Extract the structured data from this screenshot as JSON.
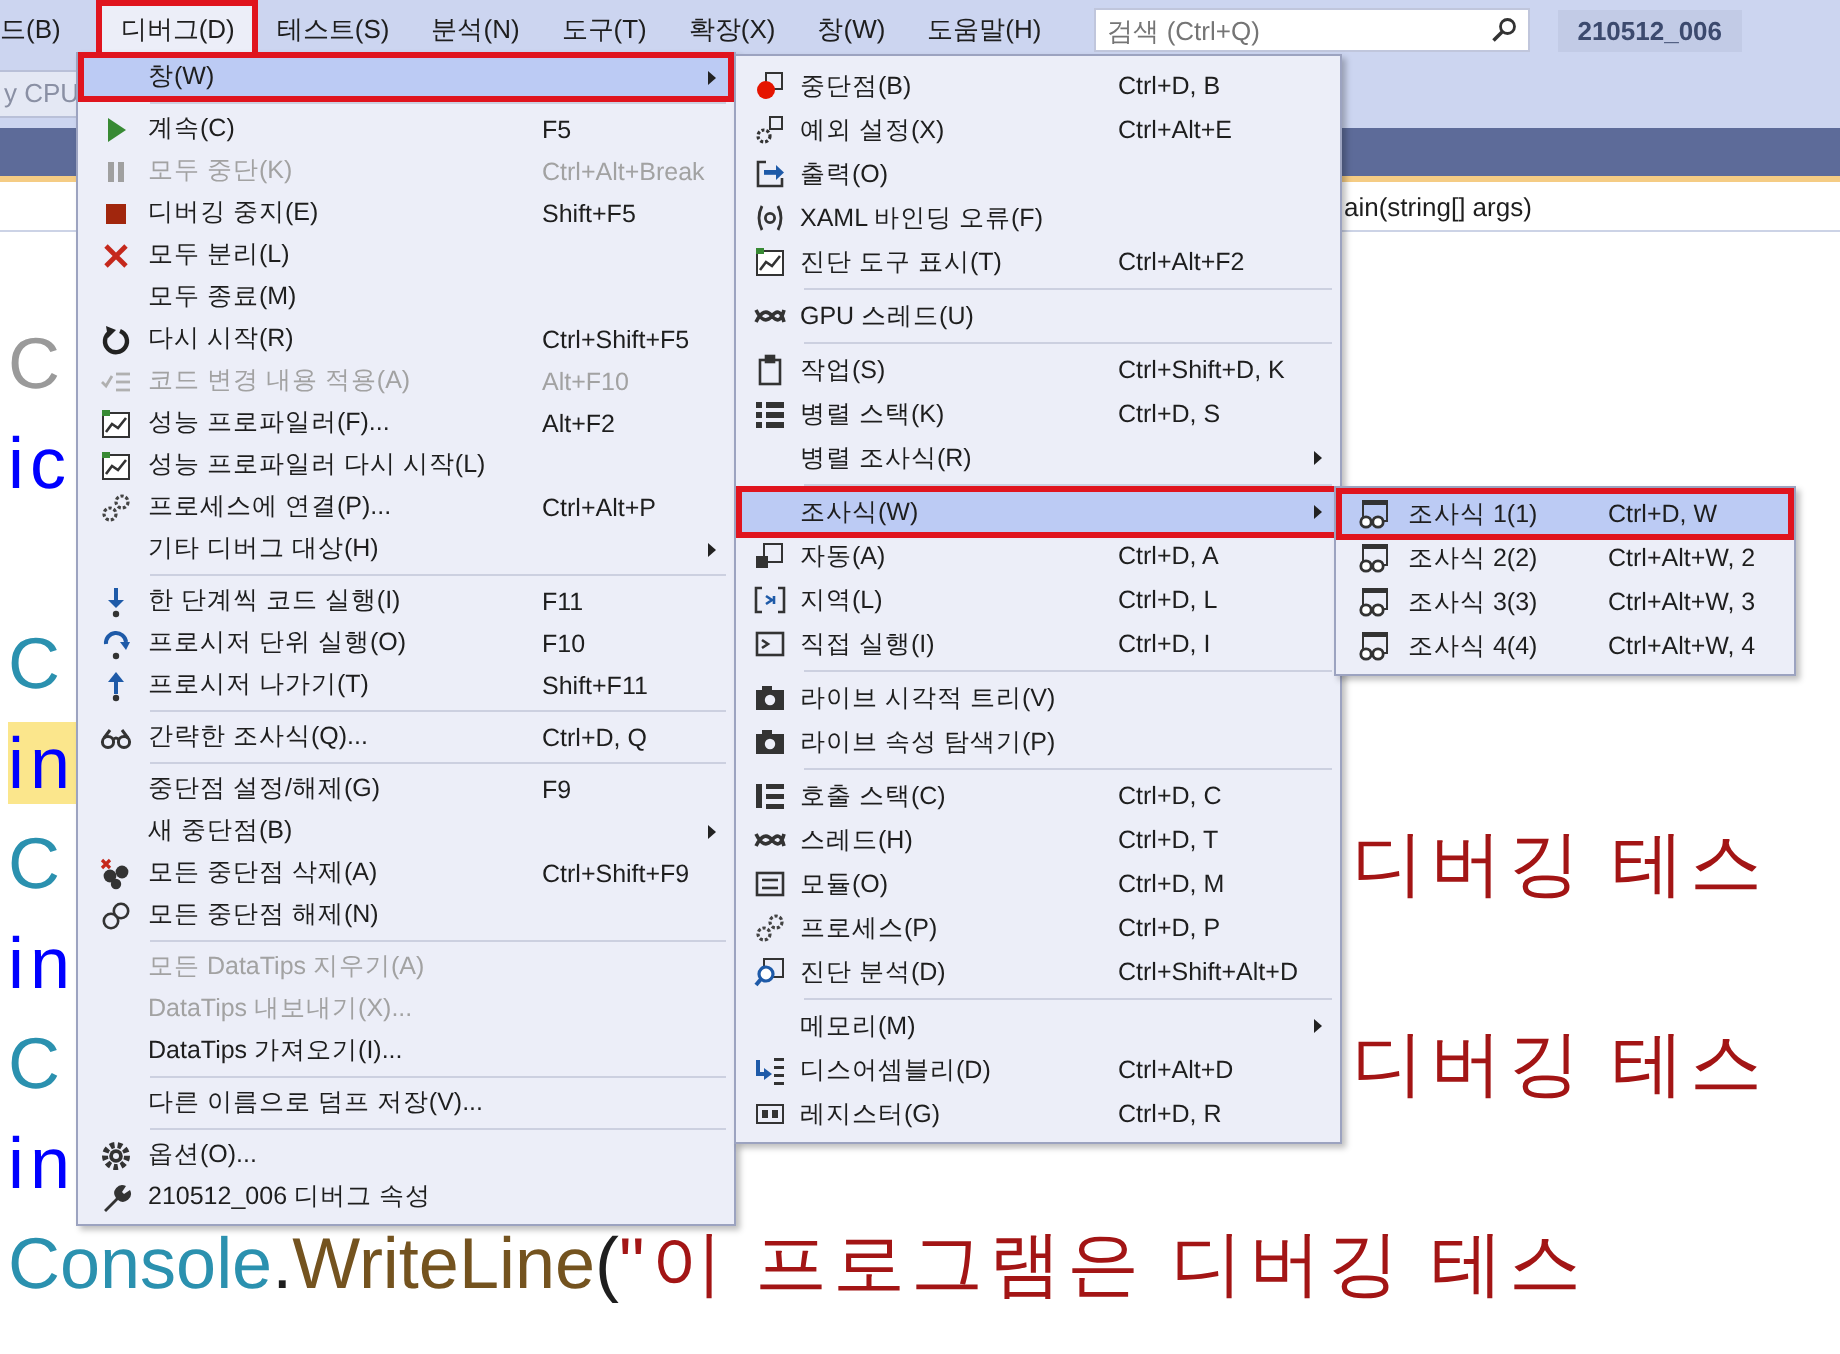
{
  "menubar": [
    {
      "label": "드(B)",
      "selected": false,
      "highlighted": false
    },
    {
      "label": "디버그(D)",
      "selected": true,
      "highlighted": true
    },
    {
      "label": "테스트(S)",
      "selected": false,
      "highlighted": false
    },
    {
      "label": "분석(N)",
      "selected": false,
      "highlighted": false
    },
    {
      "label": "도구(T)",
      "selected": false,
      "highlighted": false
    },
    {
      "label": "확장(X)",
      "selected": false,
      "highlighted": false
    },
    {
      "label": "창(W)",
      "selected": false,
      "highlighted": false
    },
    {
      "label": "도움말(H)",
      "selected": false,
      "highlighted": false
    }
  ],
  "search": {
    "placeholder": "검색 (Ctrl+Q)"
  },
  "solution_badge": "210512_006",
  "toolbar": {
    "platform": "y CPU"
  },
  "nav_bar": {
    "member": "ain(string[] args)"
  },
  "code_lines": [
    {
      "left": [
        {
          "text": "C",
          "kind": "inactive"
        }
      ]
    },
    {
      "left": [
        {
          "text": "ic",
          "kind": "keyword"
        }
      ]
    },
    {
      "left": [
        {
          "text": "C",
          "kind": "type"
        }
      ]
    },
    {
      "left": [
        {
          "text": "in",
          "kind": "keyword",
          "marked": true
        }
      ]
    },
    {
      "left": [
        {
          "text": "C",
          "kind": "type"
        }
      ],
      "right": [
        {
          "text": "디버깅 테스",
          "kind": "string"
        }
      ]
    },
    {
      "left": [
        {
          "text": "in",
          "kind": "keyword"
        }
      ]
    },
    {
      "left": [
        {
          "text": "C",
          "kind": "type"
        }
      ],
      "right": [
        {
          "text": "디버깅 테스",
          "kind": "string"
        }
      ]
    },
    {
      "left": [
        {
          "text": "in",
          "kind": "keyword"
        }
      ]
    },
    {
      "left": [
        {
          "text": "Console",
          "kind": "type"
        },
        {
          "text": ".",
          "kind": "plain"
        },
        {
          "text": "WriteLine",
          "kind": "method"
        },
        {
          "text": "(",
          "kind": "plain"
        },
        {
          "text": "\"이 프로그램은 디버깅 테스",
          "kind": "string"
        }
      ]
    }
  ],
  "menus": [
    {
      "items": [
        {
          "kind": "plain",
          "label": "창(W)",
          "submenu": true,
          "selected": true,
          "disabled": false,
          "highlighted": true
        },
        {
          "kind": "separator"
        },
        {
          "kind": "play",
          "label": "계속(C)",
          "shortcut": "F5",
          "selected": false,
          "disabled": false,
          "highlighted": false
        },
        {
          "kind": "pause",
          "label": "모두 중단(K)",
          "shortcut": "Ctrl+Alt+Break",
          "selected": false,
          "disabled": true,
          "highlighted": false
        },
        {
          "kind": "stop",
          "label": "디버깅 중지(E)",
          "shortcut": "Shift+F5",
          "selected": false,
          "disabled": false,
          "highlighted": false
        },
        {
          "kind": "cross",
          "label": "모두 분리(L)",
          "selected": false,
          "disabled": false,
          "highlighted": false
        },
        {
          "kind": "plain",
          "label": "모두 종료(M)",
          "selected": false,
          "disabled": false,
          "highlighted": false
        },
        {
          "kind": "restart",
          "label": "다시 시작(R)",
          "shortcut": "Ctrl+Shift+F5",
          "selected": false,
          "disabled": false,
          "highlighted": false
        },
        {
          "kind": "apply",
          "label": "코드 변경 내용 적용(A)",
          "shortcut": "Alt+F10",
          "selected": false,
          "disabled": true,
          "highlighted": false
        },
        {
          "kind": "chart",
          "label": "성능 프로파일러(F)...",
          "shortcut": "Alt+F2",
          "selected": false,
          "disabled": false,
          "highlighted": false
        },
        {
          "kind": "chart",
          "label": "성능 프로파일러 다시 시작(L)",
          "selected": false,
          "disabled": false,
          "highlighted": false
        },
        {
          "kind": "gears",
          "label": "프로세스에 연결(P)...",
          "shortcut": "Ctrl+Alt+P",
          "selected": false,
          "disabled": false,
          "highlighted": false
        },
        {
          "kind": "plain",
          "label": "기타 디버그 대상(H)",
          "submenu": true,
          "selected": false,
          "disabled": false,
          "highlighted": false
        },
        {
          "kind": "separator"
        },
        {
          "kind": "step_into",
          "label": "한 단계씩 코드 실행(I)",
          "shortcut": "F11",
          "selected": false,
          "disabled": false,
          "highlighted": false
        },
        {
          "kind": "step_over",
          "label": "프로시저 단위 실행(O)",
          "shortcut": "F10",
          "selected": false,
          "disabled": false,
          "highlighted": false
        },
        {
          "kind": "step_out",
          "label": "프로시저 나가기(T)",
          "shortcut": "Shift+F11",
          "selected": false,
          "disabled": false,
          "highlighted": false
        },
        {
          "kind": "separator"
        },
        {
          "kind": "glasses",
          "label": "간략한 조사식(Q)...",
          "shortcut": "Ctrl+D, Q",
          "selected": false,
          "disabled": false,
          "highlighted": false
        },
        {
          "kind": "separator"
        },
        {
          "kind": "plain",
          "label": "중단점 설정/해제(G)",
          "shortcut": "F9",
          "selected": false,
          "disabled": false,
          "highlighted": false
        },
        {
          "kind": "plain",
          "label": "새 중단점(B)",
          "submenu": true,
          "selected": false,
          "disabled": false,
          "highlighted": false
        },
        {
          "kind": "dots",
          "label": "모든 중단점 삭제(A)",
          "shortcut": "Ctrl+Shift+F9",
          "selected": false,
          "disabled": false,
          "highlighted": false
        },
        {
          "kind": "rings",
          "label": "모든 중단점 해제(N)",
          "selected": false,
          "disabled": false,
          "highlighted": false
        },
        {
          "kind": "separator"
        },
        {
          "kind": "plain",
          "label": "모든 DataTips 지우기(A)",
          "selected": false,
          "disabled": true,
          "highlighted": false
        },
        {
          "kind": "plain",
          "label": "DataTips 내보내기(X)...",
          "selected": false,
          "disabled": true,
          "highlighted": false
        },
        {
          "kind": "plain",
          "label": "DataTips 가져오기(I)...",
          "selected": false,
          "disabled": false,
          "highlighted": false
        },
        {
          "kind": "separator"
        },
        {
          "kind": "plain",
          "label": "다른 이름으로 덤프 저장(V)...",
          "selected": false,
          "disabled": false,
          "highlighted": false
        },
        {
          "kind": "separator"
        },
        {
          "kind": "gear",
          "label": "옵션(O)...",
          "selected": false,
          "disabled": false,
          "highlighted": false
        },
        {
          "kind": "wrench",
          "label": "210512_006 디버그 속성",
          "selected": false,
          "disabled": false,
          "highlighted": false
        }
      ]
    },
    {
      "items": [
        {
          "kind": "breakpoint",
          "label": "중단점(B)",
          "shortcut": "Ctrl+D, B",
          "selected": false,
          "disabled": false,
          "highlighted": false
        },
        {
          "kind": "exception",
          "label": "예외 설정(X)",
          "shortcut": "Ctrl+Alt+E",
          "selected": false,
          "disabled": false,
          "highlighted": false
        },
        {
          "kind": "output",
          "label": "출력(O)",
          "selected": false,
          "disabled": false,
          "highlighted": false
        },
        {
          "kind": "braces",
          "label": "XAML 바인딩 오류(F)",
          "selected": false,
          "disabled": false,
          "highlighted": false
        },
        {
          "kind": "chart",
          "label": "진단 도구 표시(T)",
          "shortcut": "Ctrl+Alt+F2",
          "selected": false,
          "disabled": false,
          "highlighted": false
        },
        {
          "kind": "separator"
        },
        {
          "kind": "threads",
          "label": "GPU 스레드(U)",
          "selected": false,
          "disabled": false,
          "highlighted": false
        },
        {
          "kind": "separator"
        },
        {
          "kind": "clipboard",
          "label": "작업(S)",
          "shortcut": "Ctrl+Shift+D, K",
          "selected": false,
          "disabled": false,
          "highlighted": false
        },
        {
          "kind": "grid",
          "label": "병렬 스택(K)",
          "shortcut": "Ctrl+D, S",
          "selected": false,
          "disabled": false,
          "highlighted": false
        },
        {
          "kind": "plain",
          "label": "병렬 조사식(R)",
          "submenu": true,
          "selected": false,
          "disabled": false,
          "highlighted": false
        },
        {
          "kind": "separator"
        },
        {
          "kind": "plain",
          "label": "조사식(W)",
          "submenu": true,
          "selected": true,
          "disabled": false,
          "highlighted": true
        },
        {
          "kind": "auto",
          "label": "자동(A)",
          "shortcut": "Ctrl+D, A",
          "selected": false,
          "disabled": false,
          "highlighted": false
        },
        {
          "kind": "brackets",
          "label": "지역(L)",
          "shortcut": "Ctrl+D, L",
          "selected": false,
          "disabled": false,
          "highlighted": false
        },
        {
          "kind": "terminal",
          "label": "직접 실행(I)",
          "shortcut": "Ctrl+D, I",
          "selected": false,
          "disabled": false,
          "highlighted": false
        },
        {
          "kind": "separator"
        },
        {
          "kind": "camera",
          "label": "라이브 시각적 트리(V)",
          "selected": false,
          "disabled": false,
          "highlighted": false
        },
        {
          "kind": "camera",
          "label": "라이브 속성 탐색기(P)",
          "selected": false,
          "disabled": false,
          "highlighted": false
        },
        {
          "kind": "separator"
        },
        {
          "kind": "list",
          "label": "호출 스택(C)",
          "shortcut": "Ctrl+D, C",
          "selected": false,
          "disabled": false,
          "highlighted": false
        },
        {
          "kind": "threads",
          "label": "스레드(H)",
          "shortcut": "Ctrl+D, T",
          "selected": false,
          "disabled": false,
          "highlighted": false
        },
        {
          "kind": "window",
          "label": "모듈(O)",
          "shortcut": "Ctrl+D, M",
          "selected": false,
          "disabled": false,
          "highlighted": false
        },
        {
          "kind": "gears",
          "label": "프로세스(P)",
          "shortcut": "Ctrl+D, P",
          "selected": false,
          "disabled": false,
          "highlighted": false
        },
        {
          "kind": "magnifier",
          "label": "진단 분석(D)",
          "shortcut": "Ctrl+Shift+Alt+D",
          "selected": false,
          "disabled": false,
          "highlighted": false
        },
        {
          "kind": "separator"
        },
        {
          "kind": "plain",
          "label": "메모리(M)",
          "submenu": true,
          "selected": false,
          "disabled": false,
          "highlighted": false
        },
        {
          "kind": "disassembly",
          "label": "디스어셈블리(D)",
          "shortcut": "Ctrl+Alt+D",
          "selected": false,
          "disabled": false,
          "highlighted": false
        },
        {
          "kind": "registers",
          "label": "레지스터(G)",
          "shortcut": "Ctrl+D, R",
          "selected": false,
          "disabled": false,
          "highlighted": false
        }
      ]
    },
    {
      "items": [
        {
          "kind": "watch",
          "label": "조사식 1(1)",
          "shortcut": "Ctrl+D, W",
          "selected": true,
          "disabled": false,
          "highlighted": true
        },
        {
          "kind": "watch",
          "label": "조사식 2(2)",
          "shortcut": "Ctrl+Alt+W, 2",
          "selected": false,
          "disabled": false,
          "highlighted": false
        },
        {
          "kind": "watch",
          "label": "조사식 3(3)",
          "shortcut": "Ctrl+Alt+W, 3",
          "selected": false,
          "disabled": false,
          "highlighted": false
        },
        {
          "kind": "watch",
          "label": "조사식 4(4)",
          "shortcut": "Ctrl+Alt+W, 4",
          "selected": false,
          "disabled": false,
          "highlighted": false
        }
      ]
    }
  ]
}
